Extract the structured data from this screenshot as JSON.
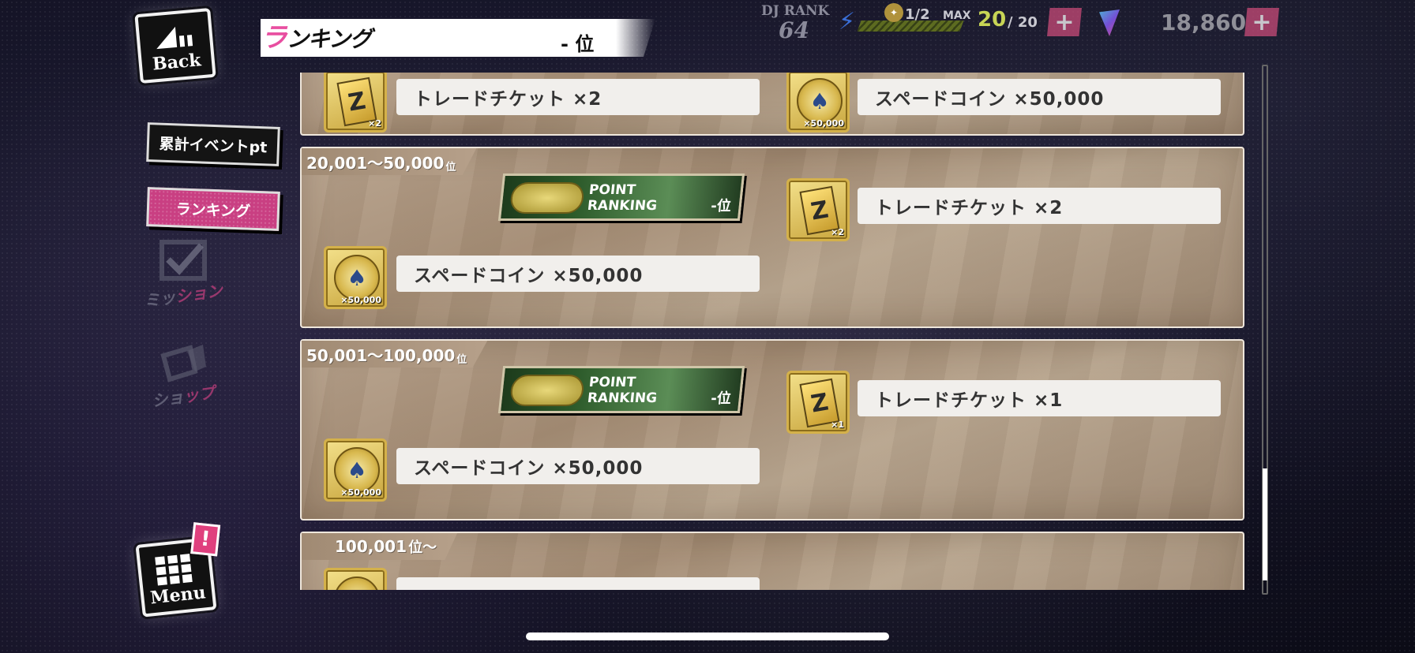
{
  "header": {
    "back_label": "Back",
    "title_first": "ラ",
    "title_rest": "ンキング",
    "rank_text": "- 位"
  },
  "status": {
    "dj_rank_label": "DJ RANK",
    "dj_rank_value": "64",
    "ratio_text": "1/2",
    "max_label": "MAX",
    "stamina_current": "20",
    "stamina_max": "/ 20",
    "gems": "18,860",
    "plus_symbol": "+"
  },
  "sidebar": {
    "tab_cumulative": "累計イベントpt",
    "tab_ranking": "ランキング",
    "mission_label_a": "ミッ",
    "mission_label_b": "ション",
    "shop_label_a": "ショ",
    "shop_label_b": "ップ"
  },
  "menu": {
    "label": "Menu",
    "badge": "!"
  },
  "panels": [
    {
      "range": "",
      "items": [
        {
          "kind": "ticket",
          "qty": "×2",
          "label": "トレードチケット ×2"
        },
        {
          "kind": "coin",
          "qty": "×50,000",
          "label": "スペードコイン ×50,000"
        }
      ]
    },
    {
      "range": "20,001～50,000",
      "range_suffix": "位",
      "plate": {
        "line1": "POINT",
        "line2": "RANKING",
        "rank": "-位"
      },
      "items": [
        {
          "kind": "ticket",
          "qty": "×2",
          "label": "トレードチケット ×2"
        },
        {
          "kind": "coin",
          "qty": "×50,000",
          "label": "スペードコイン ×50,000"
        }
      ]
    },
    {
      "range": "50,001～100,000",
      "range_suffix": "位",
      "plate": {
        "line1": "POINT",
        "line2": "RANKING",
        "rank": "-位"
      },
      "items": [
        {
          "kind": "ticket",
          "qty": "×1",
          "label": "トレードチケット ×1"
        },
        {
          "kind": "coin",
          "qty": "×50,000",
          "label": "スペードコイン ×50,000"
        }
      ]
    },
    {
      "range": "100,001",
      "range_suffix": "位～",
      "items": []
    }
  ],
  "colors": {
    "accent_pink": "#e84ea0",
    "panel_tan": "#b7a28c",
    "stamina_green": "#c7d455"
  }
}
